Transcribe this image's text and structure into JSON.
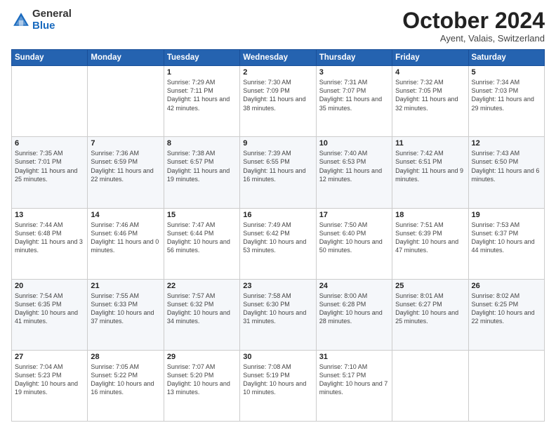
{
  "header": {
    "logo": {
      "line1": "General",
      "line2": "Blue"
    },
    "title": "October 2024",
    "subtitle": "Ayent, Valais, Switzerland"
  },
  "days_of_week": [
    "Sunday",
    "Monday",
    "Tuesday",
    "Wednesday",
    "Thursday",
    "Friday",
    "Saturday"
  ],
  "weeks": [
    [
      {
        "day": "",
        "info": ""
      },
      {
        "day": "",
        "info": ""
      },
      {
        "day": "1",
        "info": "Sunrise: 7:29 AM\nSunset: 7:11 PM\nDaylight: 11 hours and 42 minutes."
      },
      {
        "day": "2",
        "info": "Sunrise: 7:30 AM\nSunset: 7:09 PM\nDaylight: 11 hours and 38 minutes."
      },
      {
        "day": "3",
        "info": "Sunrise: 7:31 AM\nSunset: 7:07 PM\nDaylight: 11 hours and 35 minutes."
      },
      {
        "day": "4",
        "info": "Sunrise: 7:32 AM\nSunset: 7:05 PM\nDaylight: 11 hours and 32 minutes."
      },
      {
        "day": "5",
        "info": "Sunrise: 7:34 AM\nSunset: 7:03 PM\nDaylight: 11 hours and 29 minutes."
      }
    ],
    [
      {
        "day": "6",
        "info": "Sunrise: 7:35 AM\nSunset: 7:01 PM\nDaylight: 11 hours and 25 minutes."
      },
      {
        "day": "7",
        "info": "Sunrise: 7:36 AM\nSunset: 6:59 PM\nDaylight: 11 hours and 22 minutes."
      },
      {
        "day": "8",
        "info": "Sunrise: 7:38 AM\nSunset: 6:57 PM\nDaylight: 11 hours and 19 minutes."
      },
      {
        "day": "9",
        "info": "Sunrise: 7:39 AM\nSunset: 6:55 PM\nDaylight: 11 hours and 16 minutes."
      },
      {
        "day": "10",
        "info": "Sunrise: 7:40 AM\nSunset: 6:53 PM\nDaylight: 11 hours and 12 minutes."
      },
      {
        "day": "11",
        "info": "Sunrise: 7:42 AM\nSunset: 6:51 PM\nDaylight: 11 hours and 9 minutes."
      },
      {
        "day": "12",
        "info": "Sunrise: 7:43 AM\nSunset: 6:50 PM\nDaylight: 11 hours and 6 minutes."
      }
    ],
    [
      {
        "day": "13",
        "info": "Sunrise: 7:44 AM\nSunset: 6:48 PM\nDaylight: 11 hours and 3 minutes."
      },
      {
        "day": "14",
        "info": "Sunrise: 7:46 AM\nSunset: 6:46 PM\nDaylight: 11 hours and 0 minutes."
      },
      {
        "day": "15",
        "info": "Sunrise: 7:47 AM\nSunset: 6:44 PM\nDaylight: 10 hours and 56 minutes."
      },
      {
        "day": "16",
        "info": "Sunrise: 7:49 AM\nSunset: 6:42 PM\nDaylight: 10 hours and 53 minutes."
      },
      {
        "day": "17",
        "info": "Sunrise: 7:50 AM\nSunset: 6:40 PM\nDaylight: 10 hours and 50 minutes."
      },
      {
        "day": "18",
        "info": "Sunrise: 7:51 AM\nSunset: 6:39 PM\nDaylight: 10 hours and 47 minutes."
      },
      {
        "day": "19",
        "info": "Sunrise: 7:53 AM\nSunset: 6:37 PM\nDaylight: 10 hours and 44 minutes."
      }
    ],
    [
      {
        "day": "20",
        "info": "Sunrise: 7:54 AM\nSunset: 6:35 PM\nDaylight: 10 hours and 41 minutes."
      },
      {
        "day": "21",
        "info": "Sunrise: 7:55 AM\nSunset: 6:33 PM\nDaylight: 10 hours and 37 minutes."
      },
      {
        "day": "22",
        "info": "Sunrise: 7:57 AM\nSunset: 6:32 PM\nDaylight: 10 hours and 34 minutes."
      },
      {
        "day": "23",
        "info": "Sunrise: 7:58 AM\nSunset: 6:30 PM\nDaylight: 10 hours and 31 minutes."
      },
      {
        "day": "24",
        "info": "Sunrise: 8:00 AM\nSunset: 6:28 PM\nDaylight: 10 hours and 28 minutes."
      },
      {
        "day": "25",
        "info": "Sunrise: 8:01 AM\nSunset: 6:27 PM\nDaylight: 10 hours and 25 minutes."
      },
      {
        "day": "26",
        "info": "Sunrise: 8:02 AM\nSunset: 6:25 PM\nDaylight: 10 hours and 22 minutes."
      }
    ],
    [
      {
        "day": "27",
        "info": "Sunrise: 7:04 AM\nSunset: 5:23 PM\nDaylight: 10 hours and 19 minutes."
      },
      {
        "day": "28",
        "info": "Sunrise: 7:05 AM\nSunset: 5:22 PM\nDaylight: 10 hours and 16 minutes."
      },
      {
        "day": "29",
        "info": "Sunrise: 7:07 AM\nSunset: 5:20 PM\nDaylight: 10 hours and 13 minutes."
      },
      {
        "day": "30",
        "info": "Sunrise: 7:08 AM\nSunset: 5:19 PM\nDaylight: 10 hours and 10 minutes."
      },
      {
        "day": "31",
        "info": "Sunrise: 7:10 AM\nSunset: 5:17 PM\nDaylight: 10 hours and 7 minutes."
      },
      {
        "day": "",
        "info": ""
      },
      {
        "day": "",
        "info": ""
      }
    ]
  ]
}
